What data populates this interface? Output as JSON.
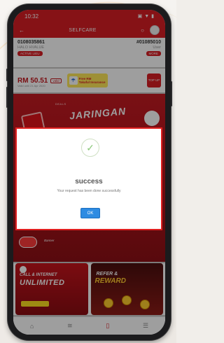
{
  "status_bar": {
    "time": "10:32",
    "signal": "▣",
    "wifi": "▼",
    "battery": "▮"
  },
  "app_bar": {
    "title": "SELFCARE",
    "back": "←",
    "bell": "○"
  },
  "account": {
    "number": "0108035861",
    "plan": "HALO HVALUE",
    "status": "ACTIVE LIEU",
    "account_id": "#01085010",
    "right_sub": "User",
    "right_pill": "MORE"
  },
  "balance": {
    "amount": "RM 50.51",
    "tag": "valid",
    "note": "Valid until 21 Apr 2020",
    "insurance_title": "Free RM",
    "insurance_sub": "Takaful Insurance",
    "topup": "TOP UP"
  },
  "promo": {
    "top_text": "DEALS",
    "title": "JARINGAN",
    "bottom_text": "Banner"
  },
  "cards": [
    {
      "line1": "CALL & INTERNET",
      "line2": "UNLIMITED"
    },
    {
      "line1": "REFER &",
      "line2": "REWARD"
    }
  ],
  "bottom_nav": {
    "home": "⌂",
    "usage": "≅",
    "phone": "▯",
    "more": "☰"
  },
  "dialog": {
    "check": "✓",
    "title": "success",
    "message": "Your request has been done successfully",
    "ok_label": "OK"
  },
  "colors": {
    "brand_red": "#d81e25",
    "ok_blue": "#2d8be2",
    "success_green": "#8bc87a"
  }
}
